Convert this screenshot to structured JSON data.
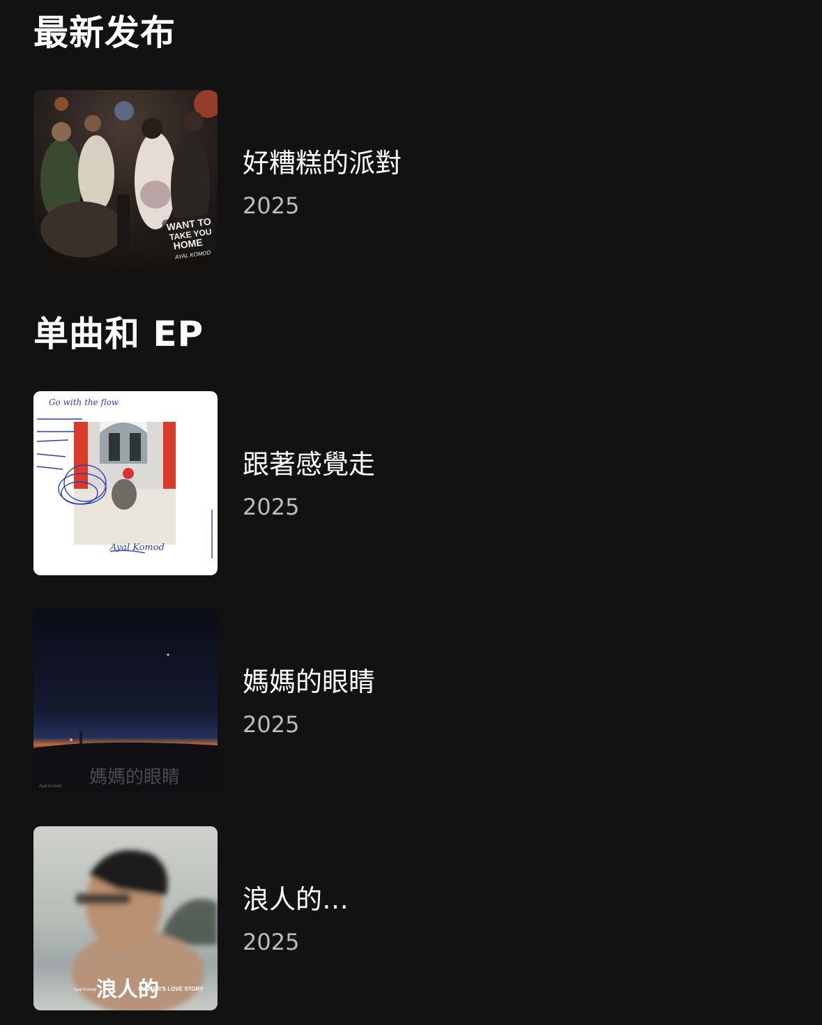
{
  "sections": {
    "latest": {
      "heading": "最新发布",
      "items": [
        {
          "title": "好糟糕的派對",
          "year": "2025",
          "cover_text": [
            "WANT TO",
            "TAKE YOU",
            "HOME",
            "AYAL KOMOD"
          ]
        }
      ]
    },
    "singles": {
      "heading": "单曲和 EP",
      "items": [
        {
          "title": "跟著感覺走",
          "year": "2025",
          "cover_text": [
            "Go with the flow",
            "Ayal Komod"
          ]
        },
        {
          "title": "媽媽的眼睛",
          "year": "2025",
          "cover_text": [
            "媽媽的眼睛",
            "Ayal Komod"
          ]
        },
        {
          "title": "浪人的…",
          "year": "2025",
          "cover_text": [
            "浪人的",
            "SURFER'S LOVE STORY",
            "Ayal Komod"
          ]
        }
      ]
    }
  },
  "colors": {
    "background": "#121212",
    "primary_text": "#ffffff",
    "secondary_text": "#bdbdbd"
  }
}
